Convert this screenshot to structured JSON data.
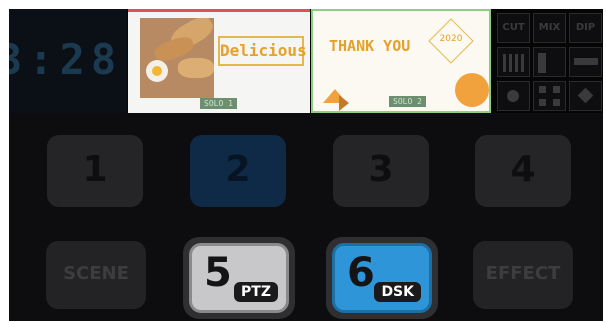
{
  "clock": {
    "text": "3:28"
  },
  "scenes": [
    {
      "title": "Delicious",
      "tag": "SOLO 1"
    },
    {
      "title": "THANK YOU",
      "year": "2020",
      "tag": "SOLO 2"
    }
  ],
  "transitions": [
    "CUT",
    "MIX",
    "DIP"
  ],
  "number_pads": [
    {
      "label": "1",
      "active": false
    },
    {
      "label": "2",
      "active": true
    },
    {
      "label": "3",
      "active": false
    },
    {
      "label": "4",
      "active": false
    }
  ],
  "bottom_row": {
    "scene_label": "SCENE",
    "ptz": {
      "number": "5",
      "tag": "PTZ"
    },
    "dsk": {
      "number": "6",
      "tag": "DSK"
    },
    "effect_label": "EFFECT"
  },
  "colors": {
    "active_pad": "#0f2a47",
    "dsk": "#2e96d8",
    "ptz": "#c8c8ca",
    "accent": "#e6a12c"
  }
}
